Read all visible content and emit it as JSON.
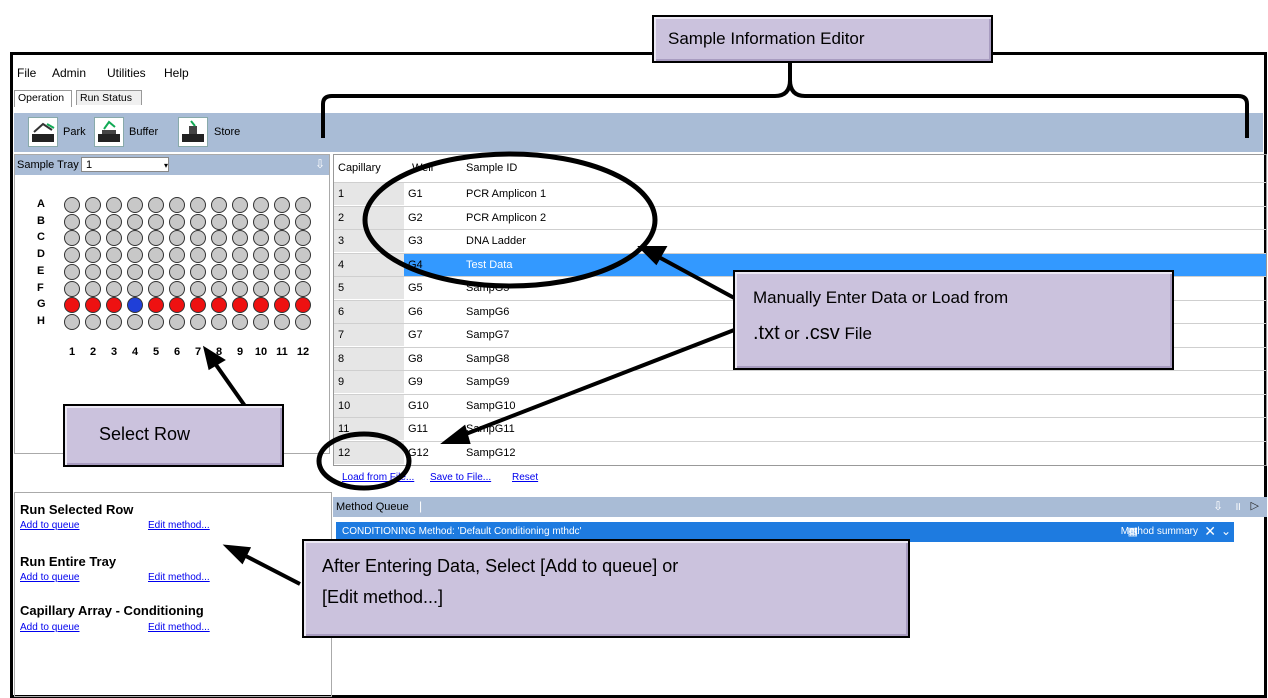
{
  "menu": [
    "File",
    "Admin",
    "Utilities",
    "Help"
  ],
  "tabs": [
    "Operation",
    "Run Status"
  ],
  "toolbar": {
    "park": "Park",
    "buffer": "Buffer",
    "store": "Store"
  },
  "tray": {
    "label": "Sample Tray #",
    "selected": "1",
    "row_labels": [
      "A",
      "B",
      "C",
      "D",
      "E",
      "F",
      "G",
      "H"
    ],
    "col_labels": [
      "1",
      "2",
      "3",
      "4",
      "5",
      "6",
      "7",
      "8",
      "9",
      "10",
      "11",
      "12"
    ],
    "selected_row": "G",
    "highlight_well": "G4",
    "colors": {
      "empty": "#c8c8c8",
      "selected": "#ee1111",
      "highlight": "#1f3fd8"
    }
  },
  "grid": {
    "headers": [
      "Capillary",
      "Well",
      "Sample ID"
    ],
    "rows": [
      {
        "cap": "1",
        "well": "G1",
        "id": "PCR Amplicon 1"
      },
      {
        "cap": "2",
        "well": "G2",
        "id": "PCR Amplicon 2"
      },
      {
        "cap": "3",
        "well": "G3",
        "id": "DNA Ladder"
      },
      {
        "cap": "4",
        "well": "G4",
        "id": "Test Data",
        "selected": true
      },
      {
        "cap": "5",
        "well": "G5",
        "id": "SampG5"
      },
      {
        "cap": "6",
        "well": "G6",
        "id": "SampG6"
      },
      {
        "cap": "7",
        "well": "G7",
        "id": "SampG7"
      },
      {
        "cap": "8",
        "well": "G8",
        "id": "SampG8"
      },
      {
        "cap": "9",
        "well": "G9",
        "id": "SampG9"
      },
      {
        "cap": "10",
        "well": "G10",
        "id": "SampG10"
      },
      {
        "cap": "11",
        "well": "G11",
        "id": "SampG11"
      },
      {
        "cap": "12",
        "well": "G12",
        "id": "SampG12"
      }
    ],
    "links": {
      "load": "Load from File...",
      "save": "Save to File...",
      "reset": "Reset"
    }
  },
  "method_queue": {
    "title": "Method Queue",
    "item": "CONDITIONING  Method: 'Default Conditioning mthdc'",
    "summary": "Method summary"
  },
  "run": {
    "selected_row": "Run Selected Row",
    "entire_tray": "Run Entire Tray",
    "conditioning": "Capillary Array - Conditioning",
    "add": "Add to queue",
    "edit": "Edit method..."
  },
  "callouts": {
    "editor": "Sample Information Editor",
    "manual_line1": "Manually Enter Data or Load from",
    "manual_ext1": ".txt",
    "manual_or": " or ",
    "manual_ext2": ".csv",
    "manual_file": " File",
    "select_row": "Select Row",
    "after_line1": "After Entering Data, Select [Add to queue] or",
    "after_line2": "[Edit method...]"
  }
}
